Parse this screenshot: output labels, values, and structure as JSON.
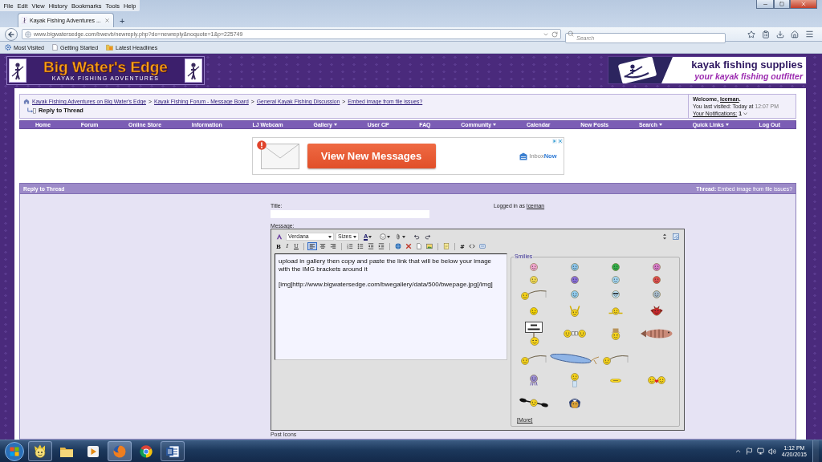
{
  "browser": {
    "menu": [
      "File",
      "Edit",
      "View",
      "History",
      "Bookmarks",
      "Tools",
      "Help"
    ],
    "tabs": [
      {
        "title": "Kayak Fishing Adventures ...",
        "selected": true
      }
    ],
    "new_tab": "+",
    "url": "www.bigwatersedge.com/bwevb/newreply.php?do=newreply&noquote=1&p=225749",
    "search": {
      "placeholder": "Search"
    },
    "bookmarks": [
      {
        "kind": "most-visited",
        "label": "Most Visited"
      },
      {
        "kind": "page",
        "label": "Getting Started"
      },
      {
        "kind": "feed",
        "label": "Latest Headlines"
      }
    ]
  },
  "banner": {
    "logo_title": "Big Water's Edge",
    "logo_subtitle": "KAYAK FISHING ADVENTURES",
    "ad_title": "kayak fishing supplies",
    "ad_subtitle": "your kayak fishing outfitter"
  },
  "breadcrumb": {
    "items": [
      {
        "kind": "link",
        "text": "Kayak Fishing Adventures on Big Water's Edge"
      },
      {
        "kind": "separator",
        "text": ">"
      },
      {
        "kind": "link",
        "text": "Kayak Fishing Forum - Message Board"
      },
      {
        "kind": "separator",
        "text": ">"
      },
      {
        "kind": "link",
        "text": "General Kayak Fishing Discussion"
      },
      {
        "kind": "separator",
        "text": ">"
      },
      {
        "kind": "link",
        "text": "Embed image from file issues?"
      }
    ],
    "current": "Reply to Thread"
  },
  "welcome": {
    "before": "Welcome,",
    "user": "Iceman",
    "after": ".",
    "last_visited": "You last visited: Today at",
    "last_visited_time": "12:07 PM",
    "notifications_label": "Your Notifications:",
    "notifications_count": "1"
  },
  "nav": [
    {
      "label": "Home",
      "dropdown": false
    },
    {
      "label": "Forum",
      "dropdown": false
    },
    {
      "label": "Online Store",
      "dropdown": false
    },
    {
      "label": "Information",
      "dropdown": false
    },
    {
      "label": "LJ Webcam",
      "dropdown": false
    },
    {
      "label": "Gallery",
      "dropdown": true
    },
    {
      "label": "User CP",
      "dropdown": false
    },
    {
      "label": "FAQ",
      "dropdown": false
    },
    {
      "label": "Community",
      "dropdown": true
    },
    {
      "label": "Calendar",
      "dropdown": false
    },
    {
      "label": "New Posts",
      "dropdown": false
    },
    {
      "label": "Search",
      "dropdown": true
    },
    {
      "label": "Quick Links",
      "dropdown": true
    },
    {
      "label": "Log Out",
      "dropdown": false
    }
  ],
  "ad": {
    "button": "View New Messages",
    "brand": "Inbox**Now**"
  },
  "reply_panel": {
    "title": "Reply to Thread",
    "thread": "**Thread:** Embed image from file issues?"
  },
  "form": {
    "title_label": "Title:",
    "logged_in_label": "Logged in as",
    "user": "Iceman",
    "message_label": "Message:",
    "post_icons_label": "Post Icons"
  },
  "editor": {
    "toolbar_top": [
      {
        "kind": "logo"
      },
      {
        "kind": "font",
        "value": "Verdana"
      },
      {
        "kind": "size",
        "value": "Sizes"
      },
      {
        "kind": "color",
        "label": "A"
      },
      {
        "kind": "smiley"
      },
      {
        "kind": "attach"
      },
      {
        "kind": "undo"
      },
      {
        "kind": "redo"
      },
      {
        "kind": "resize"
      },
      {
        "kind": "mode"
      }
    ],
    "toolbar_bottom": [
      [
        {
          "kind": "bold",
          "label": "B",
          "selected": false
        },
        {
          "kind": "italic",
          "label": "I",
          "selected": false
        },
        {
          "kind": "underline",
          "label": "U",
          "selected": false
        }
      ],
      [
        {
          "kind": "align-left",
          "selected": true
        },
        {
          "kind": "align-center",
          "selected": false
        },
        {
          "kind": "align-right",
          "selected": false
        }
      ],
      [
        {
          "kind": "ordered-list",
          "selected": false
        },
        {
          "kind": "bullet-list",
          "selected": false
        },
        {
          "kind": "outdent",
          "selected": false
        },
        {
          "kind": "indent",
          "selected": false
        }
      ],
      [
        {
          "kind": "link",
          "selected": false
        },
        {
          "kind": "unlink",
          "selected": false
        },
        {
          "kind": "document",
          "selected": false
        },
        {
          "kind": "image",
          "selected": false
        }
      ],
      [
        {
          "kind": "quote",
          "selected": false
        }
      ],
      [
        {
          "kind": "hash",
          "label": "#",
          "selected": false
        },
        {
          "kind": "code",
          "selected": false
        },
        {
          "kind": "snippet",
          "selected": false
        }
      ]
    ],
    "content": [
      "upload in gallery then copy and paste the link that will be below your image with the IMG brackets around it",
      "[img]http://www.bigwatersedge.com/bwegallery/data/500/bwepage.jpg[/img]"
    ],
    "smilies_legend": "Smilies",
    "smilies": [
      [
        {
          "kind": "face",
          "color": "#f2a7cf"
        },
        {
          "kind": "face",
          "color": "#8cc6ec"
        },
        {
          "kind": "face",
          "color": "#33b04a"
        },
        {
          "kind": "face",
          "color": "#d77bc9"
        }
      ],
      [
        {
          "kind": "face",
          "color": "#f3dc55"
        },
        {
          "kind": "face",
          "color": "#8a70dc"
        },
        {
          "kind": "face",
          "color": "#a4d6f2"
        },
        {
          "kind": "face",
          "color": "#df4f4f"
        }
      ],
      [
        {
          "kind": "rod"
        },
        {
          "kind": "face",
          "color": "#92cdef"
        },
        {
          "kind": "shades"
        },
        {
          "kind": "face",
          "color": "#a9bccb"
        }
      ],
      [
        {
          "kind": "face",
          "color": "#f5d400"
        },
        {
          "kind": "hands"
        },
        {
          "kind": "wave"
        },
        {
          "kind": "devil"
        }
      ],
      [
        {
          "kind": "sign"
        },
        {
          "kind": "duo"
        },
        {
          "kind": "hat"
        },
        {
          "kind": "fish"
        }
      ],
      [
        {
          "kind": "rod"
        },
        {
          "kind": "lure"
        },
        {
          "kind": "rod"
        }
      ],
      [
        {
          "kind": "octopus"
        },
        {
          "kind": "pedestal"
        },
        {
          "kind": "flat"
        },
        {
          "kind": "kiss"
        }
      ],
      [
        {
          "kind": "paddle"
        },
        {
          "kind": "pirate"
        }
      ]
    ],
    "more_link": "[More]"
  },
  "taskbar": {
    "apps": [
      {
        "kind": "cartoon",
        "running": true,
        "selected": false
      },
      {
        "kind": "folder",
        "running": false,
        "selected": false
      },
      {
        "kind": "media",
        "running": false,
        "selected": false
      },
      {
        "kind": "firefox",
        "running": true,
        "selected": true
      },
      {
        "kind": "chrome",
        "running": false,
        "selected": false
      },
      {
        "kind": "word",
        "running": true,
        "selected": false
      }
    ],
    "time": "1:12 PM",
    "date": "4/20/2015"
  }
}
